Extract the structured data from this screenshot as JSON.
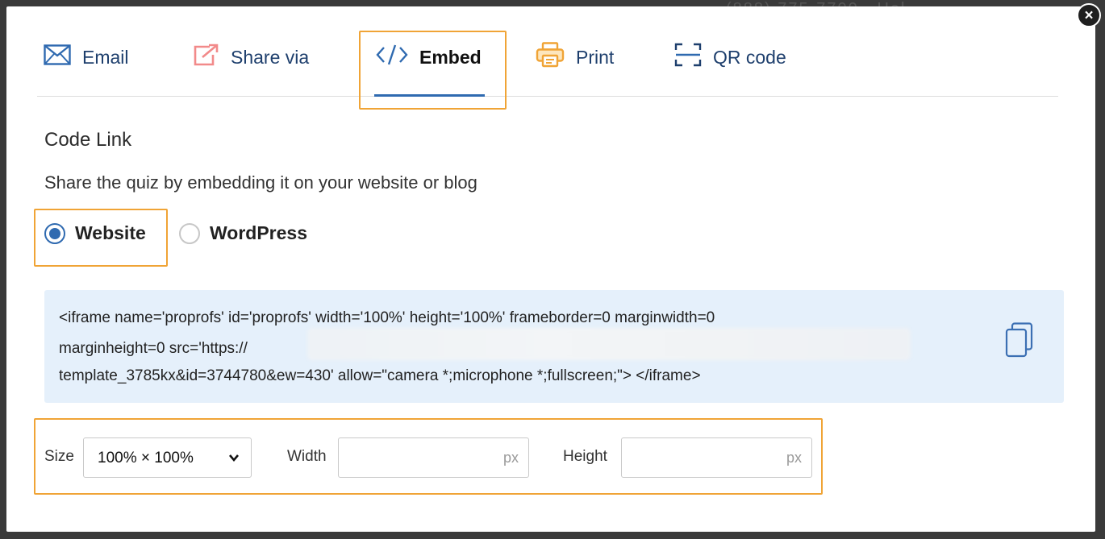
{
  "background": {
    "top_strip_text": "(888) 775-7700",
    "top_strip_right": "Hel"
  },
  "modal": {
    "close_label": "×"
  },
  "tabs": [
    {
      "label": "Email",
      "icon": "envelope-icon"
    },
    {
      "label": "Share via",
      "icon": "external-share-icon"
    },
    {
      "label": "Embed",
      "icon": "code-icon",
      "active": true
    },
    {
      "label": "Print",
      "icon": "printer-icon"
    },
    {
      "label": "QR code",
      "icon": "qr-scan-icon"
    }
  ],
  "section": {
    "title": "Code Link",
    "description": "Share the quiz by embedding it on your website or blog"
  },
  "radio_options": [
    {
      "label": "Website",
      "selected": true
    },
    {
      "label": "WordPress",
      "selected": false
    }
  ],
  "embed_code": {
    "line1": "<iframe name='proprofs' id='proprofs' width='100%' height='100%' frameborder=0 marginwidth=0",
    "line2": "marginheight=0 src='https://",
    "line3": "template_3785kx&id=3744780&ew=430' allow=\"camera *;microphone *;fullscreen;\"> </iframe>",
    "copy_icon": "copy-icon"
  },
  "size_controls": {
    "size_label": "Size",
    "size_value": "100% × 100%",
    "width_label": "Width",
    "width_value": "",
    "width_unit": "px",
    "height_label": "Height",
    "height_value": "",
    "height_unit": "px"
  },
  "colors": {
    "accent": "#2f6ab0",
    "highlight": "#f0a436",
    "code_bg": "#e5f0fb"
  }
}
